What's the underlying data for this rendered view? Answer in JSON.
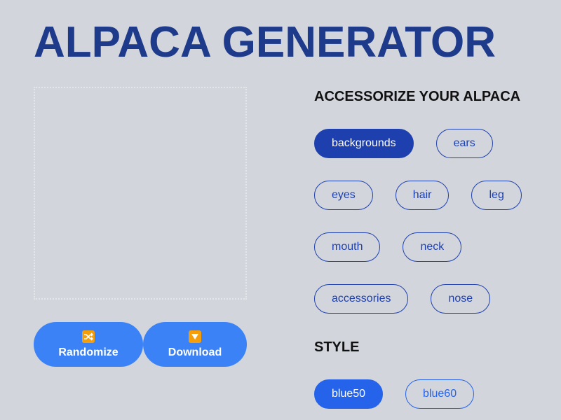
{
  "app": {
    "title": "ALPACA GENERATOR"
  },
  "actions": {
    "randomize_label": "Randomize",
    "download_label": "Download",
    "randomize_icon": "shuffle-icon",
    "download_icon": "download-arrow-icon"
  },
  "accessorize": {
    "heading": "ACCESSORIZE YOUR ALPACA",
    "selected": "backgrounds",
    "rows": [
      [
        "backgrounds",
        "ears"
      ],
      [
        "eyes",
        "hair",
        "leg"
      ],
      [
        "mouth",
        "neck"
      ],
      [
        "accessories",
        "nose"
      ]
    ]
  },
  "style": {
    "heading": "STYLE",
    "selected": "blue50",
    "options": [
      "blue50",
      "blue60"
    ]
  },
  "colors": {
    "background": "#d2d5dc",
    "title": "#1e3a8a",
    "primary": "#1e40af",
    "accent_button": "#3b82f6",
    "style_active": "#2563eb",
    "icon_bg": "#f59e0b"
  }
}
